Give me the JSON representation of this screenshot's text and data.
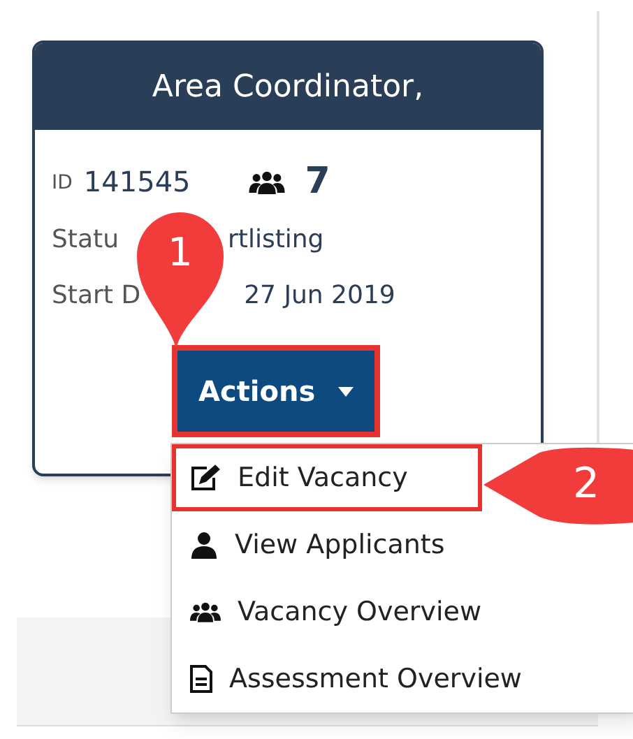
{
  "card": {
    "title": "Area Coordinator,",
    "id_label": "ID",
    "id_value": "141545",
    "applicant_count": "7",
    "status_label": "Statu",
    "status_value": "rtlisting",
    "start_label": "Start D",
    "start_value": "27 Jun 2019",
    "actions_button": {
      "label": "Actions",
      "highlighted": true
    }
  },
  "menu": {
    "items": [
      {
        "kind": "edit",
        "label": "Edit Vacancy",
        "highlighted": true
      },
      {
        "kind": "person",
        "label": "View Applicants",
        "highlighted": false
      },
      {
        "kind": "group",
        "label": "Vacancy Overview",
        "highlighted": false
      },
      {
        "kind": "document",
        "label": "Assessment Overview",
        "highlighted": false
      }
    ]
  },
  "callouts": [
    {
      "number": "1"
    },
    {
      "number": "2"
    }
  ]
}
